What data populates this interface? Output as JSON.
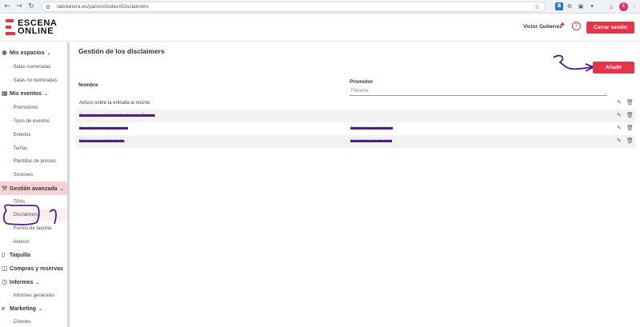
{
  "browser": {
    "url": "laticketera.es/pa/rest/index#Disclaimers",
    "back_icon": "arrow-left",
    "forward_icon": "arrow-right",
    "reload_icon": "reload",
    "profile_initial": "E"
  },
  "header": {
    "logo_line1": "ESCENA",
    "logo_line2": "ONLINE",
    "user_name": "Victor Gutierrez",
    "help_label": "?",
    "logout_label": "Cerrar sesión",
    "brand_color": "#e8344b"
  },
  "sidebar": {
    "mis_espacios": "Mis espacios",
    "salas_numeradas": "· Salas numeradas",
    "salas_no_numeradas": "· Salas no numeradas",
    "mis_eventos": "Mis eventos",
    "promotores": "· Promotores",
    "tipos_eventos": "· Tipos de eventos",
    "eventos": "· Eventos",
    "tarifas": "· Tarifas",
    "plantillas": "· Plantillas de precios",
    "sesiones": "· Sesiones",
    "gestion_avanzada": "Gestión avanzada",
    "tpvs": "· TPVs",
    "disclaimers": "· Disclaimers",
    "puntos_taquilla": "· Puntos de taquilla",
    "abonos": "· Abonos",
    "taquilla": "Taquilla",
    "compras_reservas": "Compras y reservas",
    "informes": "Informes",
    "informes_generales": "· Informes generales",
    "marketing": "Marketing",
    "clientes": "· Clientes"
  },
  "main": {
    "title": "Gestión de los disclaimers",
    "add_label": "Añadir",
    "col_nombre": "Nombre",
    "col_promotor": "Promotor",
    "filter_placeholder": "Filtrame",
    "rows": [
      {
        "nombre": "Avisos sobre la entrada al recinto",
        "promotor": ""
      },
      {
        "nombre": "Condiciones Sala Master del Teatro",
        "promotor": ""
      },
      {
        "nombre": "Condiciones generales",
        "promotor": "Promotor redactado"
      },
      {
        "nombre": "Disclaimer redactado",
        "promotor": "Promotor de la sala"
      }
    ]
  }
}
